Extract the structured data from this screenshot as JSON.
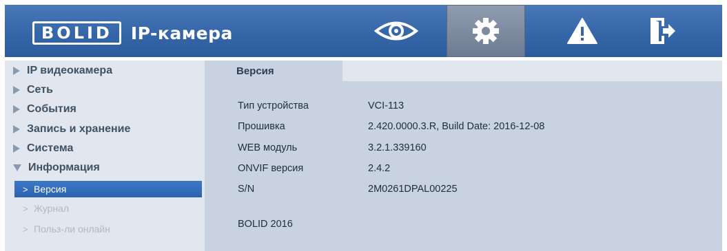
{
  "header": {
    "logo_text": "BOLID",
    "title": "IP-камера",
    "nav": [
      {
        "icon": "eye-icon"
      },
      {
        "icon": "gear-icon"
      },
      {
        "icon": "warning-icon"
      },
      {
        "icon": "logout-icon"
      }
    ]
  },
  "sidebar": {
    "items": [
      {
        "label": "IP видеокамера"
      },
      {
        "label": "Сеть"
      },
      {
        "label": "События"
      },
      {
        "label": "Запись и хранение"
      },
      {
        "label": "Система"
      },
      {
        "label": "Информация"
      }
    ],
    "subitems": [
      {
        "label": "Версия",
        "active": true
      },
      {
        "label": "Журнал"
      },
      {
        "label": "Польз-ли онлайн"
      }
    ]
  },
  "main": {
    "tab_label": "Версия",
    "rows": [
      {
        "label": "Тип устройства",
        "value": "VCI-113"
      },
      {
        "label": "Прошивка",
        "value": "2.420.0000.3.R, Build Date: 2016-12-08"
      },
      {
        "label": "WEB модуль",
        "value": "3.2.1.339160"
      },
      {
        "label": "ONVIF версия",
        "value": "2.4.2"
      },
      {
        "label": "S/N",
        "value": "2M0261DPAL00225"
      }
    ],
    "footer": "BOLID 2016"
  },
  "colors": {
    "header_blue": "#3566a8",
    "active_item": "#2b62b0",
    "content_bg": "#c8d2e0"
  }
}
